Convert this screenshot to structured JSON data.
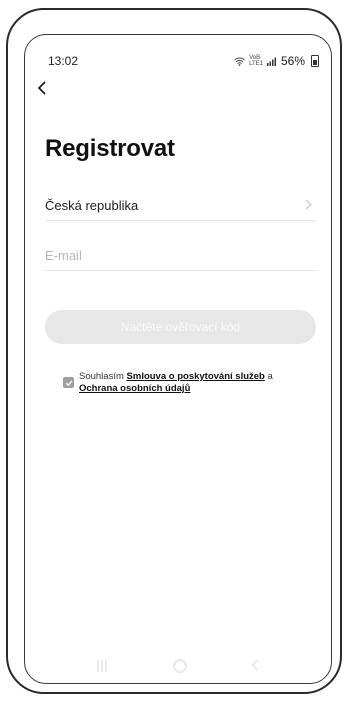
{
  "status_bar": {
    "time": "13:02",
    "volte": "VoB",
    "lte": "LTE1",
    "battery": "56%"
  },
  "icons": {
    "back": "chevron-left-icon",
    "country_arrow": "chevron-right-icon",
    "wifi": "wifi-icon",
    "signal": "signal-icon",
    "battery": "battery-icon",
    "checkbox": "checkbox-checked-icon"
  },
  "header": {
    "title": "Registrovat"
  },
  "form": {
    "country": "Česká republika",
    "email_placeholder": "E-mail",
    "code_button": "Načtěte ověřovací kód"
  },
  "agreement": {
    "prefix": "Souhlasím",
    "terms_link": "Smlouva o poskytování služeb",
    "connector": "a",
    "privacy_link": "Ochrana osobních údajů",
    "checked": true
  },
  "colors": {
    "button_bg": "#e7e7e7",
    "checkbox": "#9e9e9e",
    "divider": "#e4e4e4"
  }
}
